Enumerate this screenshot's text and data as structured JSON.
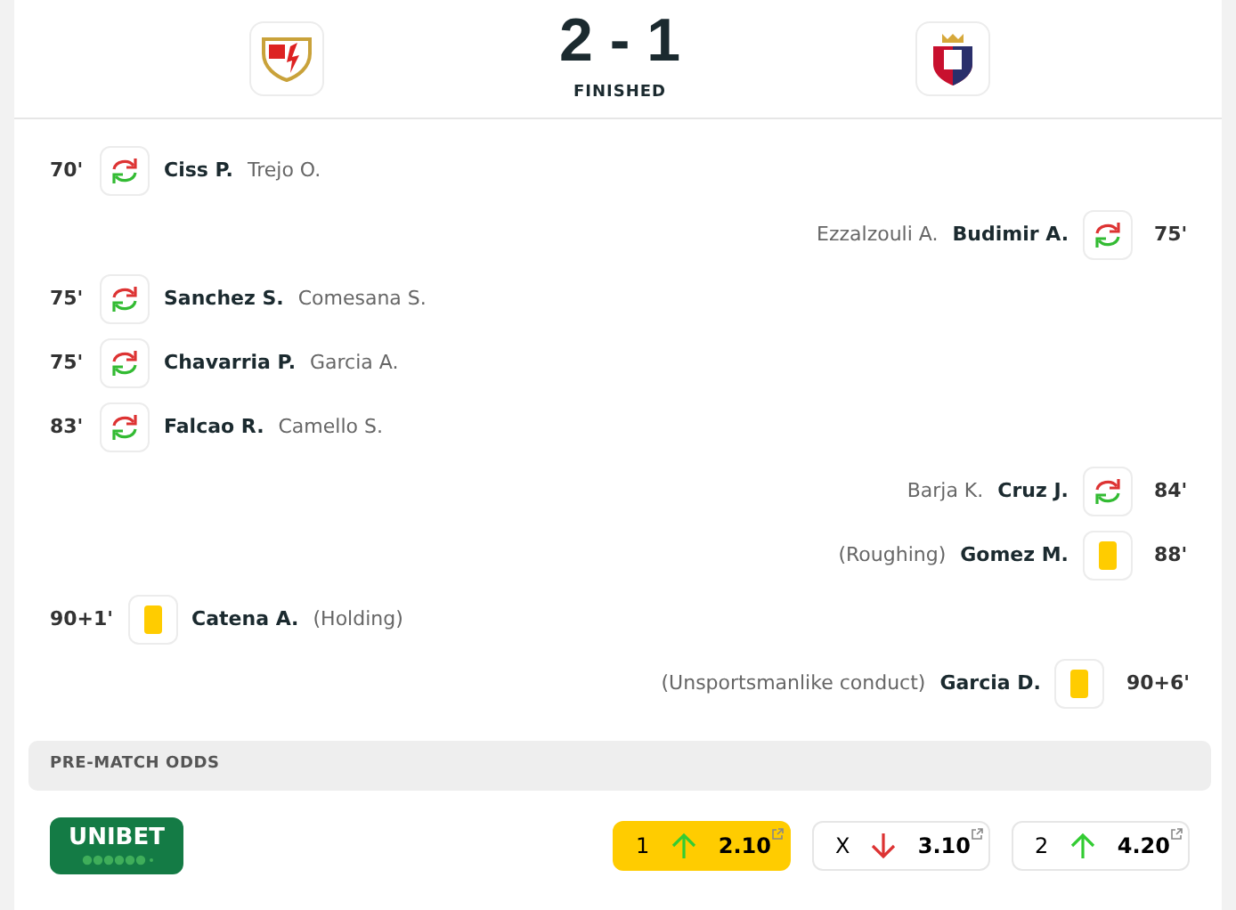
{
  "match": {
    "score": "2 - 1",
    "status": "FINISHED"
  },
  "events": [
    {
      "away": false,
      "minute": "70'",
      "kind": "substitution",
      "player": "Ciss P.",
      "detail": "Trejo O."
    },
    {
      "away": true,
      "minute": "75'",
      "kind": "substitution",
      "player": "Budimir A.",
      "detail": "Ezzalzouli A."
    },
    {
      "away": false,
      "minute": "75'",
      "kind": "substitution",
      "player": "Sanchez S.",
      "detail": "Comesana S."
    },
    {
      "away": false,
      "minute": "75'",
      "kind": "substitution",
      "player": "Chavarria P.",
      "detail": "Garcia A."
    },
    {
      "away": false,
      "minute": "83'",
      "kind": "substitution",
      "player": "Falcao R.",
      "detail": "Camello S."
    },
    {
      "away": true,
      "minute": "84'",
      "kind": "substitution",
      "player": "Cruz J.",
      "detail": "Barja K."
    },
    {
      "away": true,
      "minute": "88'",
      "kind": "card",
      "color": "#ffcc00",
      "player": "Gomez M.",
      "detail": "(Roughing)"
    },
    {
      "away": false,
      "minute": "90+1'",
      "kind": "card",
      "color": "#ffcc00",
      "player": "Catena A.",
      "detail": "(Holding)"
    },
    {
      "away": true,
      "minute": "90+6'",
      "kind": "card",
      "color": "#ffcc00",
      "player": "Garcia D.",
      "detail": "(Unsportsmanlike conduct)"
    }
  ],
  "odds": {
    "title": "PRE-MATCH ODDS",
    "bookmaker": "UNIBET",
    "options": [
      {
        "label": "1",
        "up": true,
        "value": "2.10",
        "selected": true
      },
      {
        "label": "X",
        "up": false,
        "value": "3.10",
        "selected": false
      },
      {
        "label": "2",
        "up": true,
        "value": "4.20",
        "selected": false
      }
    ]
  }
}
